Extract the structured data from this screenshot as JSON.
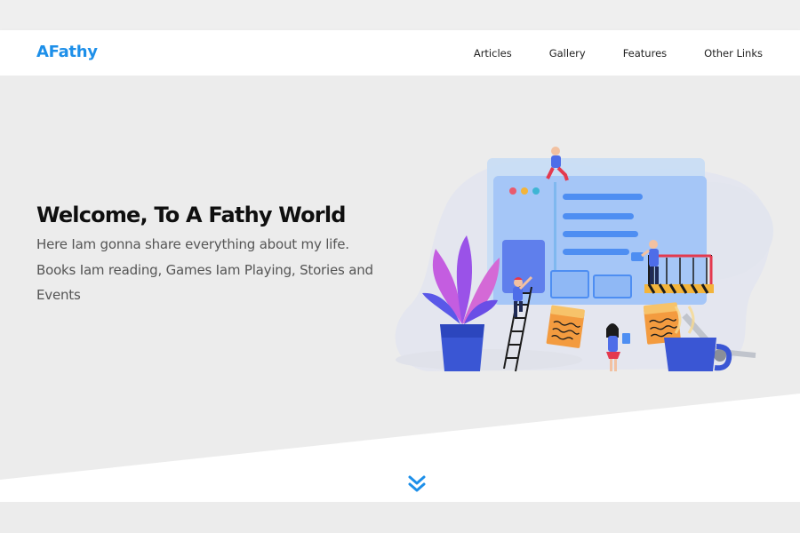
{
  "header": {
    "logo": "AFathy",
    "nav": [
      {
        "label": "Articles"
      },
      {
        "label": "Gallery"
      },
      {
        "label": "Features"
      },
      {
        "label": "Other Links"
      }
    ]
  },
  "landing": {
    "title": "Welcome, To A Fathy World",
    "description": "Here Iam gonna share everything about my life. Books Iam reading, Games Iam Playing, Stories and Events"
  },
  "icons": {
    "scroll_down": "double-chevron-down-icon"
  },
  "colors": {
    "accent": "#1d8fe9",
    "background": "#ececec",
    "header_bg": "#ffffff",
    "title": "#0f0f0f",
    "text": "#555555"
  }
}
